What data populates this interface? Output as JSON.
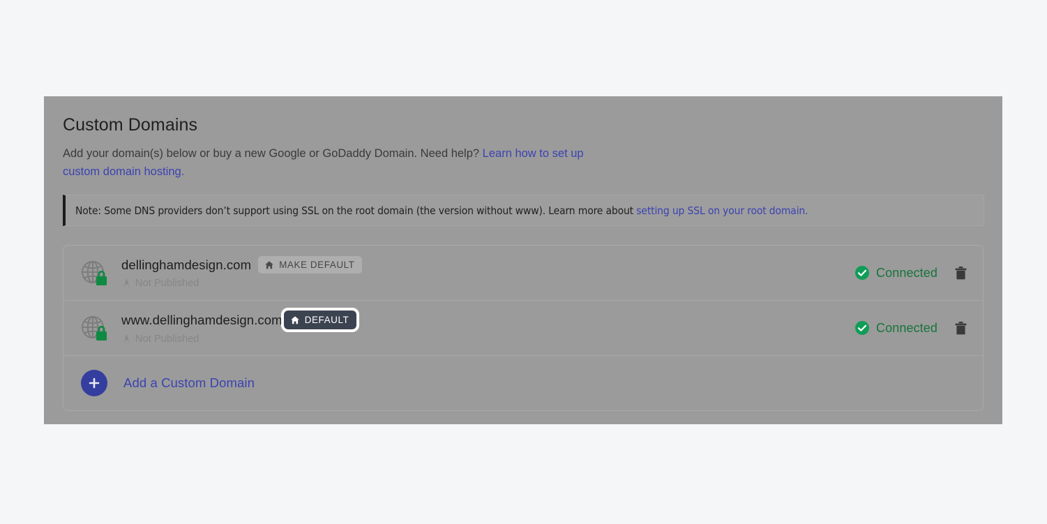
{
  "panel": {
    "title": "Custom Domains",
    "description_before_link": "Add your domain(s) below or buy a new Google or GoDaddy Domain. Need help? ",
    "description_link": "Learn how to set up custom domain hosting.",
    "note": {
      "text_before_link": "Note: Some DNS providers don’t support using SSL on the root domain (the version without www). Learn more about ",
      "link": "setting up SSL on your root domain.",
      "accent_bar_color": "#1c1c1c"
    }
  },
  "colors": {
    "page_background": "#f4f6f8",
    "overlay_panel": "#9b9b9b",
    "link": "#3b43b0",
    "connected_green": "#17743b",
    "check_green": "#0f9d58",
    "lock_green": "#0f8a43",
    "default_badge": "#3b4350",
    "focus_ring": "#ffffff"
  },
  "domains": [
    {
      "name": "dellinghamdesign.com",
      "icon": "globe-lock-icon",
      "badge": {
        "label": "MAKE DEFAULT",
        "icon": "home-icon",
        "style": "make-default",
        "focused": false
      },
      "publish_status": {
        "icon": "rocket-icon",
        "label": "Not Published"
      },
      "connection": {
        "icon": "check-circle-icon",
        "label": "Connected"
      },
      "delete_icon": "trash-icon"
    },
    {
      "name": "www.dellinghamdesign.com",
      "icon": "globe-lock-icon",
      "badge": {
        "label": "DEFAULT",
        "icon": "home-icon",
        "style": "default",
        "focused": true
      },
      "publish_status": {
        "icon": "rocket-icon",
        "label": "Not Published"
      },
      "connection": {
        "icon": "check-circle-icon",
        "label": "Connected"
      },
      "delete_icon": "trash-icon"
    }
  ],
  "add_row": {
    "icon": "plus-icon",
    "label": "Add a Custom Domain"
  }
}
